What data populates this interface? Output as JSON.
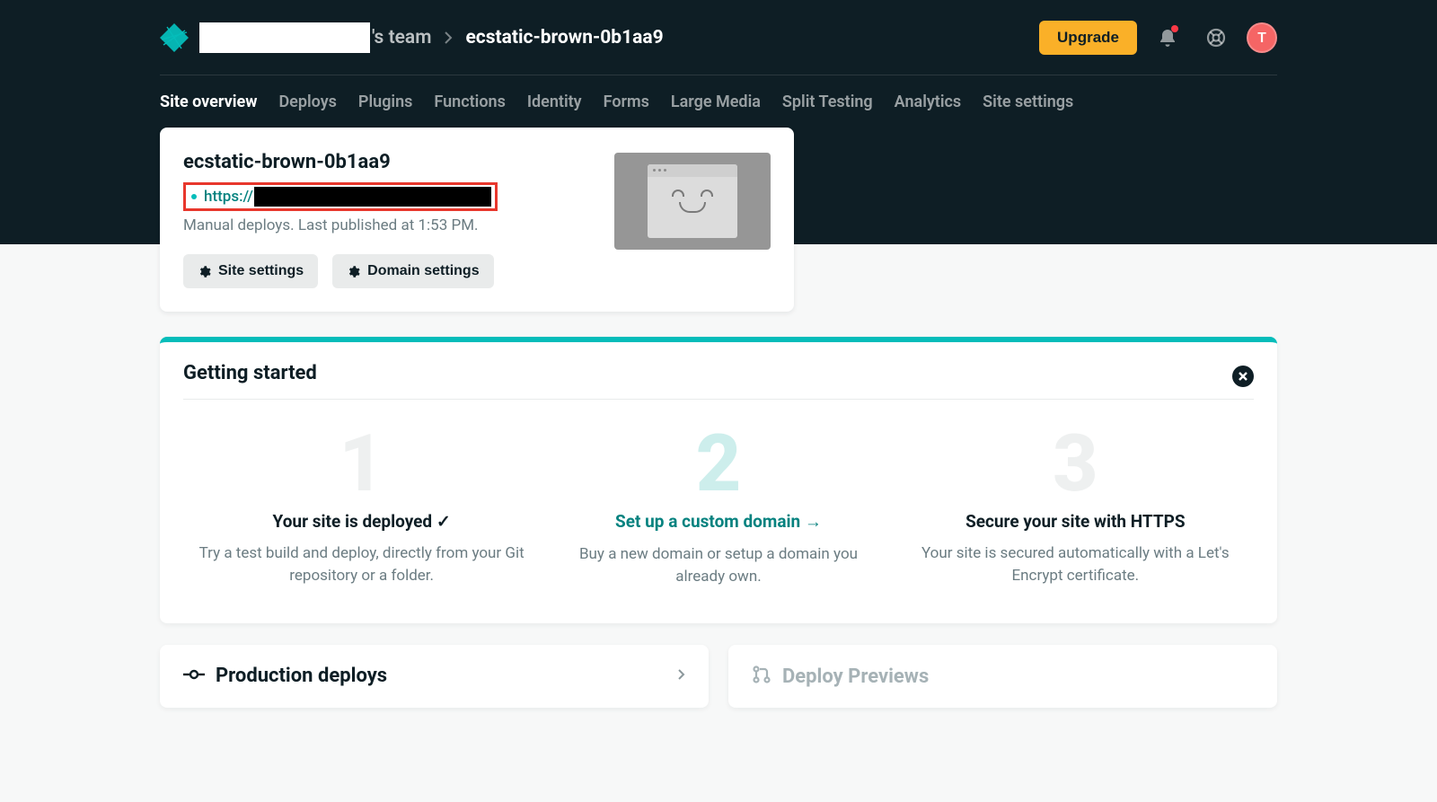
{
  "colors": {
    "accent": "#05bdba",
    "accent_dark": "#05827f",
    "header_bg": "#0e1e25",
    "upgrade_bg": "#fab028",
    "highlight_border": "#e8372c",
    "avatar_bg": "#f56565"
  },
  "header": {
    "team_suffix": "'s team",
    "crumb_current": "ecstatic-brown-0b1aa9",
    "upgrade_label": "Upgrade",
    "avatar_initial": "T"
  },
  "nav": {
    "items": [
      "Site overview",
      "Deploys",
      "Plugins",
      "Functions",
      "Identity",
      "Forms",
      "Large Media",
      "Split Testing",
      "Analytics",
      "Site settings"
    ],
    "active_index": 0
  },
  "site_card": {
    "name": "ecstatic-brown-0b1aa9",
    "url_prefix": "https://",
    "deploy_meta": "Manual deploys. Last published at 1:53 PM.",
    "site_settings_label": "Site settings",
    "domain_settings_label": "Domain settings"
  },
  "getting_started": {
    "title": "Getting started",
    "steps": [
      {
        "num": "1",
        "title": "Your site is deployed ✓",
        "desc": "Try a test build and deploy, directly from your Git repository or a folder."
      },
      {
        "num": "2",
        "title": "Set up a custom domain →",
        "desc": "Buy a new domain or setup a domain you already own."
      },
      {
        "num": "3",
        "title": "Secure your site with HTTPS",
        "desc": "Your site is secured automatically with a Let's Encrypt certificate."
      }
    ],
    "active_index": 1
  },
  "bottom": {
    "production_deploys": "Production deploys",
    "deploy_previews": "Deploy Previews"
  }
}
